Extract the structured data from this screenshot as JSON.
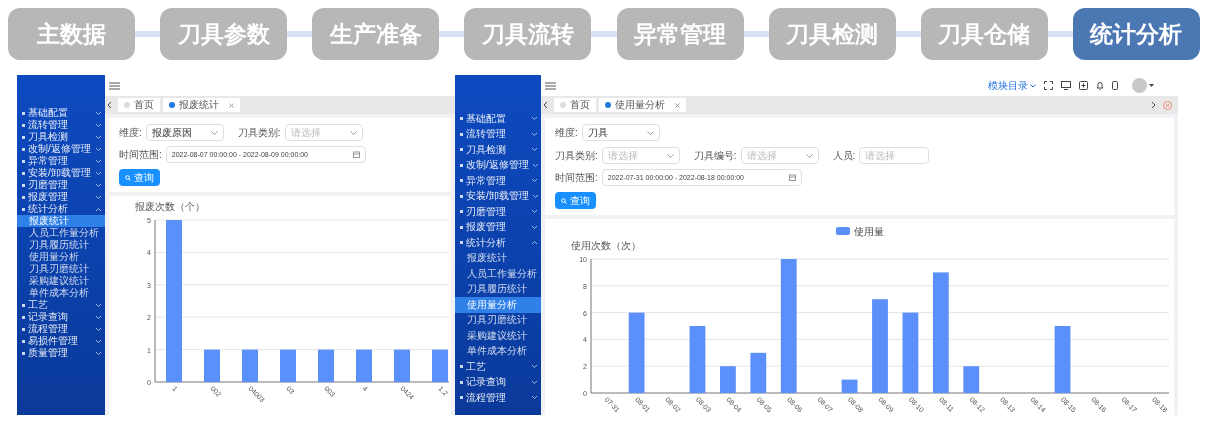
{
  "process_steps": [
    {
      "label": "主数据",
      "selected": false
    },
    {
      "label": "刀具参数",
      "selected": false
    },
    {
      "label": "生产准备",
      "selected": false
    },
    {
      "label": "刀具流转",
      "selected": false
    },
    {
      "label": "异常管理",
      "selected": false
    },
    {
      "label": "刀具检测",
      "selected": false
    },
    {
      "label": "刀具仓储",
      "selected": false
    },
    {
      "label": "统计分析",
      "selected": true
    }
  ],
  "screens": [
    {
      "sidebar": {
        "items": [
          {
            "label": "基础配置",
            "expanded": false
          },
          {
            "label": "流转管理",
            "expanded": false
          },
          {
            "label": "刀具检测",
            "expanded": false
          },
          {
            "label": "改制/返修管理",
            "expanded": false
          },
          {
            "label": "异常管理",
            "expanded": false
          },
          {
            "label": "安装/卸载管理",
            "expanded": false
          },
          {
            "label": "刃磨管理",
            "expanded": false
          },
          {
            "label": "报废管理",
            "expanded": false
          },
          {
            "label": "统计分析",
            "expanded": true,
            "children": [
              {
                "label": "报废统计",
                "selected": true
              },
              {
                "label": "人员工作量分析",
                "selected": false
              },
              {
                "label": "刀具履历统计",
                "selected": false
              },
              {
                "label": "使用量分析",
                "selected": false
              },
              {
                "label": "刀具刃磨统计",
                "selected": false
              },
              {
                "label": "采购建议统计",
                "selected": false
              },
              {
                "label": "单件成本分析",
                "selected": false
              }
            ]
          },
          {
            "label": "工艺",
            "expanded": false
          },
          {
            "label": "记录查询",
            "expanded": false
          },
          {
            "label": "流程管理",
            "expanded": false
          },
          {
            "label": "易损件管理",
            "expanded": false
          },
          {
            "label": "质量管理",
            "expanded": false
          }
        ]
      },
      "tabs": [
        {
          "label": "首页",
          "selected": false
        },
        {
          "label": "报废统计",
          "selected": true
        }
      ],
      "filter_rows": [
        [
          {
            "label": "维度:",
            "kind": "select",
            "value": "报废原因"
          },
          {
            "label": "刀具类别:",
            "kind": "select",
            "placeholder": "请选择"
          },
          {
            "label": "时间范围:",
            "kind": "date",
            "value": "2022-08-07 00:00:00 - 2022-08-09 00:00:00"
          }
        ]
      ],
      "search_button": "查询",
      "chart": {
        "chart_data": {
          "type": "bar",
          "ylabel": "报废次数（个）",
          "categories": [
            "1",
            "002",
            "04003",
            "03",
            "003",
            "4",
            "0424",
            "1.2"
          ],
          "values": [
            5,
            1,
            1,
            1,
            1,
            1,
            1,
            1
          ],
          "grid": true,
          "ylim": [
            0,
            5
          ],
          "yticks": [
            0,
            1,
            2,
            3,
            4,
            5
          ]
        }
      }
    },
    {
      "header": {
        "menu_label": "模块目录"
      },
      "sidebar": {
        "items": [
          {
            "label": "基础配置",
            "expanded": false
          },
          {
            "label": "流转管理",
            "expanded": false
          },
          {
            "label": "刀具检测",
            "expanded": false
          },
          {
            "label": "改制/返修管理",
            "expanded": false
          },
          {
            "label": "异常管理",
            "expanded": false
          },
          {
            "label": "安装/卸载管理",
            "expanded": false
          },
          {
            "label": "刃磨管理",
            "expanded": false
          },
          {
            "label": "报废管理",
            "expanded": false
          },
          {
            "label": "统计分析",
            "expanded": true,
            "children": [
              {
                "label": "报废统计",
                "selected": false
              },
              {
                "label": "人员工作量分析",
                "selected": false
              },
              {
                "label": "刀具履历统计",
                "selected": false
              },
              {
                "label": "使用量分析",
                "selected": true
              },
              {
                "label": "刀具刃磨统计",
                "selected": false
              },
              {
                "label": "采购建议统计",
                "selected": false
              },
              {
                "label": "单件成本分析",
                "selected": false
              }
            ]
          },
          {
            "label": "工艺",
            "expanded": false
          },
          {
            "label": "记录查询",
            "expanded": false
          },
          {
            "label": "流程管理",
            "expanded": false
          }
        ]
      },
      "tabs": [
        {
          "label": "首页",
          "selected": false
        },
        {
          "label": "使用量分析",
          "selected": true
        }
      ],
      "filter_rows": [
        [
          {
            "label": "维度:",
            "kind": "select",
            "value": "刀具"
          }
        ],
        [
          {
            "label": "刀具类别:",
            "kind": "select",
            "placeholder": "请选择"
          },
          {
            "label": "刀具编号:",
            "kind": "select",
            "placeholder": "请选择"
          },
          {
            "label": "人员:",
            "kind": "input",
            "placeholder": "请选择"
          },
          {
            "label": "时间范围:",
            "kind": "date",
            "value": "2022-07-31 00:00:00 - 2022-08-18 00:00:00"
          }
        ]
      ],
      "search_button": "查询",
      "chart": {
        "chart_data": {
          "type": "bar",
          "ylabel": "使用次数（次）",
          "categories": [
            "07-31",
            "08-01",
            "08-02",
            "08-03",
            "08-04",
            "08-05",
            "08-06",
            "08-07",
            "08-08",
            "08-09",
            "08-10",
            "08-11",
            "08-12",
            "08-13",
            "08-14",
            "08-15",
            "08-16",
            "08-17",
            "08-18"
          ],
          "series": [
            {
              "name": "使用量",
              "color": "#5b8ff9",
              "values": [
                0,
                6,
                0,
                5,
                2,
                3,
                10,
                0,
                1,
                7,
                6,
                9,
                2,
                0,
                0,
                5,
                0,
                0,
                0
              ]
            }
          ],
          "grid": true,
          "ylim": [
            0,
            10
          ],
          "yticks": [
            0,
            2,
            4,
            6,
            8,
            10
          ]
        }
      }
    }
  ]
}
